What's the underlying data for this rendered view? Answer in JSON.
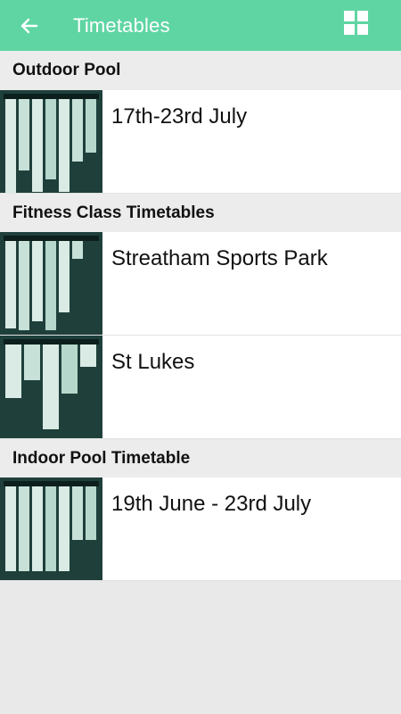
{
  "header": {
    "title": "Timetables",
    "back_icon": "back-arrow-icon",
    "grid_icon": "grid-view-icon"
  },
  "sections": [
    {
      "title": "Outdoor Pool",
      "items": [
        {
          "label": "17th-23rd July"
        }
      ]
    },
    {
      "title": "Fitness Class Timetables",
      "items": [
        {
          "label": "Streatham Sports Park"
        },
        {
          "label": "St Lukes"
        }
      ]
    },
    {
      "title": "Indoor Pool Timetable",
      "items": [
        {
          "label": "19th June - 23rd July"
        }
      ]
    }
  ],
  "colors": {
    "appbar": "#5fd5a3",
    "thumb_bg": "#1f3f3b"
  }
}
